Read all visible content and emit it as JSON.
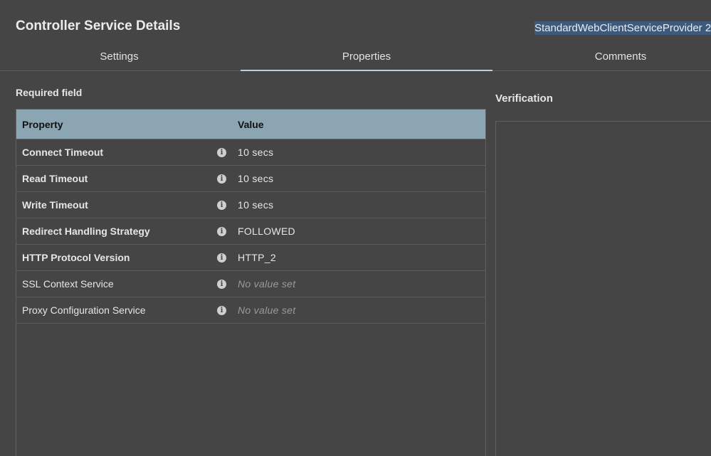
{
  "dialog": {
    "title": "Controller Service Details",
    "service_name": "StandardWebClientServiceProvider 2"
  },
  "tabs": [
    {
      "label": "Settings",
      "active": false
    },
    {
      "label": "Properties",
      "active": true
    },
    {
      "label": "Comments",
      "active": false
    }
  ],
  "properties": {
    "required_label": "Required field",
    "columns": {
      "property": "Property",
      "value": "Value"
    },
    "rows": [
      {
        "name": "Connect Timeout",
        "value": "10 secs",
        "required": true,
        "is_set": true
      },
      {
        "name": "Read Timeout",
        "value": "10 secs",
        "required": true,
        "is_set": true
      },
      {
        "name": "Write Timeout",
        "value": "10 secs",
        "required": true,
        "is_set": true
      },
      {
        "name": "Redirect Handling Strategy",
        "value": "FOLLOWED",
        "required": true,
        "is_set": true
      },
      {
        "name": "HTTP Protocol Version",
        "value": "HTTP_2",
        "required": true,
        "is_set": true
      },
      {
        "name": "SSL Context Service",
        "value": "No value set",
        "required": false,
        "is_set": false
      },
      {
        "name": "Proxy Configuration Service",
        "value": "No value set",
        "required": false,
        "is_set": false
      }
    ]
  },
  "verification": {
    "label": "Verification"
  },
  "colors": {
    "background": "#454545",
    "table_header": "#8ba5b3",
    "active_tab_underline": "#b9cfe0",
    "selection_highlight": "#3d5a7a"
  },
  "icons": {
    "info": "info-icon"
  }
}
